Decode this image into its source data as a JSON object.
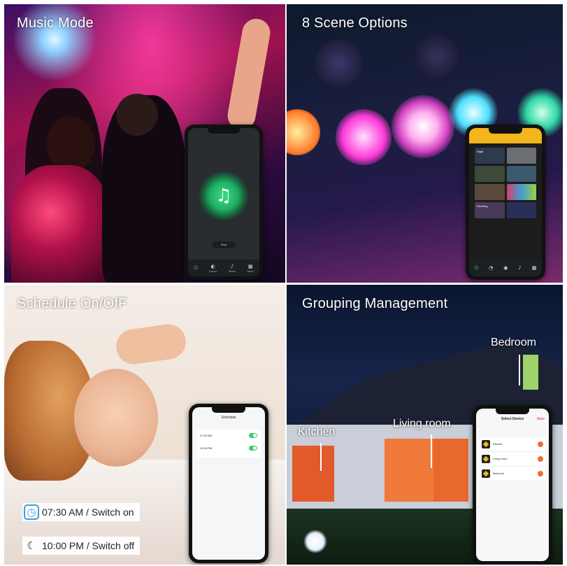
{
  "panels": {
    "music": {
      "title": "Music Mode"
    },
    "scenes": {
      "title": "8 Scene Options"
    },
    "schedule": {
      "title": "Schedule On/OfF"
    },
    "grouping": {
      "title": "Grouping Management"
    }
  },
  "schedule_captions": [
    {
      "icon": "alarm-clock-icon",
      "text": "07:30 AM / Switch on"
    },
    {
      "icon": "moon-icon",
      "text": "10:00 PM / Switch off"
    }
  ],
  "house_labels": {
    "bedroom": "Bedroom",
    "kitchen": "Kitchen",
    "living_room": "Living room"
  },
  "phones": {
    "music": {
      "stop_label": "Stop",
      "tabs": [
        "Scene",
        "Music",
        "More"
      ]
    },
    "schedule": {
      "title": "Schedule",
      "items": [
        {
          "time": "07:30 AM"
        },
        {
          "time": "10:00 PM"
        }
      ]
    },
    "device": {
      "title": "Select Device",
      "save": "Save",
      "devices": [
        "Kitchen",
        "Living room",
        "Bedroom"
      ]
    },
    "scenes": {
      "tiles": [
        "Night",
        "",
        "",
        "",
        "",
        "",
        "Dazzling",
        ""
      ]
    }
  },
  "colors": {
    "accent_green": "#3ddc84",
    "app_yellow": "#f2b61c",
    "select_orange": "#f36a2a"
  }
}
